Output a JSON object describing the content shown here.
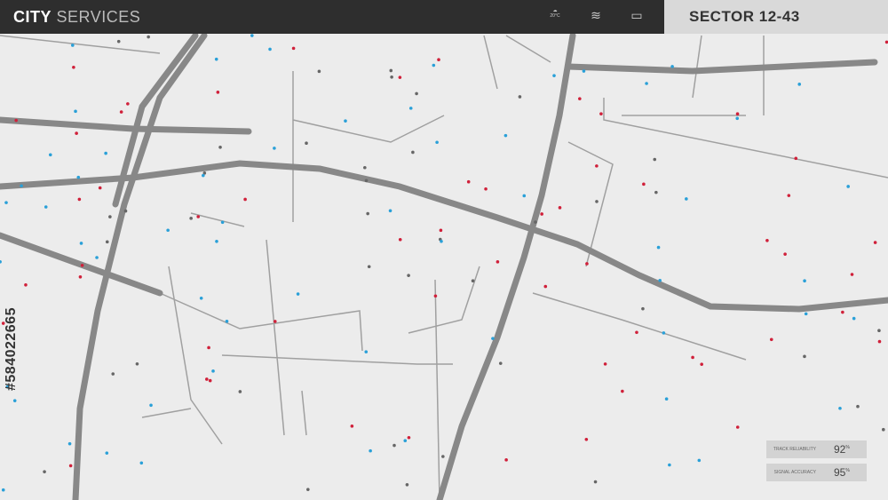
{
  "header": {
    "title_bold": "CITY",
    "title_rest": "SERVICES",
    "weather": "20°C",
    "icons": [
      "cloud-icon",
      "wifi-icon",
      "chat-icon"
    ]
  },
  "sector": {
    "label": "SECTOR 12-43"
  },
  "stats": [
    {
      "label": "TRACK RELIABILITY",
      "value": "92",
      "unit": "%"
    },
    {
      "label": "SIGNAL ACCURACY",
      "value": "95",
      "unit": "%"
    }
  ],
  "watermark": "#584022665",
  "colors": {
    "red": "#d0203a",
    "blue": "#2aa0d8",
    "road": "#8a8a8a"
  }
}
